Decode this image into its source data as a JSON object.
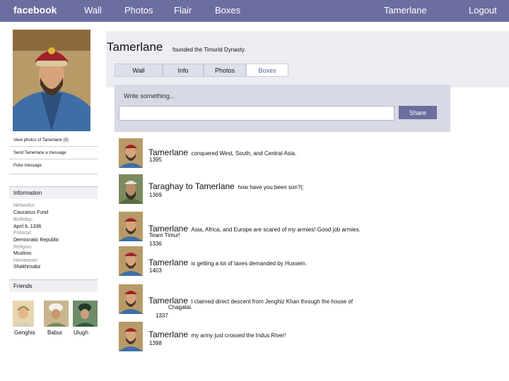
{
  "nav": {
    "logo": "facebook",
    "links": [
      "Wall",
      "Photos",
      "Flair",
      "Boxes"
    ],
    "user": "Tamerlane",
    "logout": "Logout"
  },
  "profile": {
    "name": "Tamerlane",
    "tagline": "founded the Timurid Dynasty.",
    "tabs": [
      "Wall",
      "Info",
      "Photos",
      "Boxes"
    ],
    "active_tab": "Boxes"
  },
  "sidebar": {
    "view_photos": "View photos of Tamerlane (5)",
    "send_message": "Send Tamerlane a message",
    "poke": "Poke message",
    "information_title": "Information",
    "info": [
      {
        "label": "Networks:",
        "value": "Caucasus Fund"
      },
      {
        "label": "Birthday:",
        "value": "April 8, 1336"
      },
      {
        "label": "Political:",
        "value": "Democratic Republic"
      },
      {
        "label": "Religion:",
        "value": "Muslims"
      },
      {
        "label": "Hometown:",
        "value": "Shakhrisabz"
      }
    ],
    "friends_title": "Friends",
    "friends": [
      "Genghis",
      "Babur",
      "Ulugh"
    ]
  },
  "composer": {
    "label": "Write something...",
    "placeholder": "",
    "share": "Share"
  },
  "posts": [
    {
      "author": "Tamerlane",
      "text": "conquered West, South, and Central Asia.",
      "continued": "",
      "date": "1395"
    },
    {
      "author": "Taraghay to Tamerlane",
      "text": "how have you been son?(:",
      "continued": "",
      "date": "1369"
    },
    {
      "author": "Tamerlane",
      "text": "Asia, Africa, and Europe are scared of my armies! Good job armies.",
      "continued": "Team Timur!",
      "date": "1336"
    },
    {
      "author": "Tamerlane",
      "text": "is getting a lot of taxes demanded by Hussein.",
      "continued": "",
      "date": "1403"
    },
    {
      "author": "Tamerlane",
      "text": "I claimed direct descent from Jenghiz Khan through the house of",
      "continued": "Chagatai.",
      "date": "1337"
    },
    {
      "author": "Tamerlane",
      "text": "my army just crossed the Indus River!",
      "continued": "",
      "date": "1398"
    }
  ],
  "colors": {
    "topbar": "#6d6ea0",
    "band": "#ecedf3",
    "composer": "#d7d9e4",
    "active_tab_text": "#5662a8"
  }
}
